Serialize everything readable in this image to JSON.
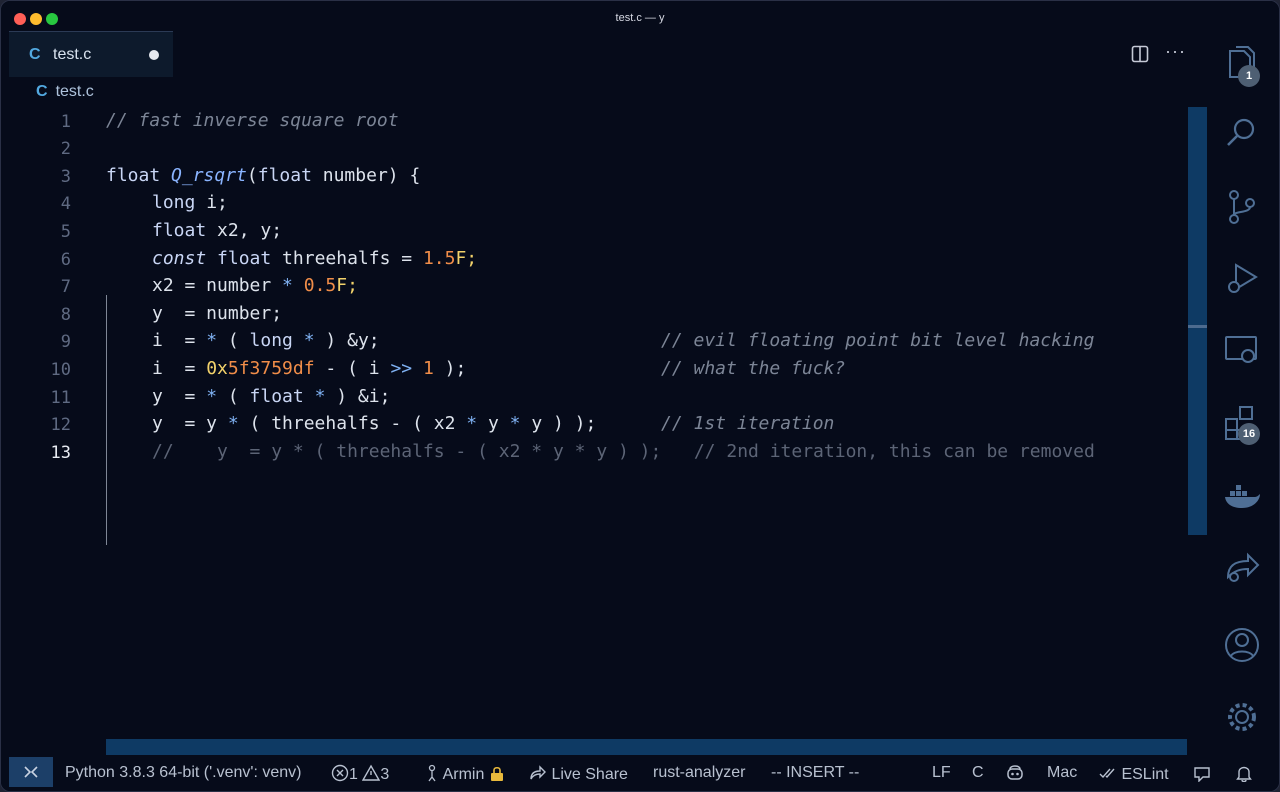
{
  "window": {
    "title": "test.c — y"
  },
  "tab": {
    "icon_letter": "C",
    "name": "test.c"
  },
  "breadcrumb": {
    "icon_letter": "C",
    "file": "test.c"
  },
  "editor": {
    "active_line": 13,
    "lines": [
      {
        "n": "1",
        "comment": "// fast inverse square root"
      },
      {
        "n": "2"
      },
      {
        "n": "3",
        "kw1": "float ",
        "fn": "Q_rsqrt",
        "p1": "(",
        "kw2": "float",
        "rest": " number) {"
      },
      {
        "n": "4",
        "kw": "long",
        "rest": " i;"
      },
      {
        "n": "5",
        "kw": "float",
        "rest": " x2, y;"
      },
      {
        "n": "6",
        "kw_it": "const",
        "kw": " float",
        "rest": " threehalfs = ",
        "num": "1.5",
        "suffix": "F;"
      },
      {
        "n": "7",
        "a": "x2 = number ",
        "op": "*",
        "b": " ",
        "num": "0.5",
        "suffix": "F;"
      },
      {
        "n": "8",
        "a": "y  = number;"
      },
      {
        "n": "9",
        "a": "i  = ",
        "op1": "*",
        "b": " ( ",
        "kw": "long",
        "c": " ",
        "op2": "*",
        "d": " ) &y;",
        "comment": "// evil floating point bit level hacking"
      },
      {
        "n": "10",
        "a": "i  = ",
        "hex_prefix": "0x",
        "hex": "5f3759df",
        "b": " - ( i ",
        "op": ">>",
        "c": " ",
        "num": "1",
        "d": " );",
        "comment": "// what the fuck?"
      },
      {
        "n": "11",
        "a": "y  = ",
        "op1": "*",
        "b": " ( ",
        "kw": "float",
        "c": " ",
        "op2": "*",
        "d": " ) &i;"
      },
      {
        "n": "12",
        "a": "y  = y ",
        "op1": "*",
        "b": " ( threehalfs - ( x2 ",
        "op2": "*",
        "c": " y ",
        "op3": "*",
        "d": " y ) );",
        "comment": "// 1st iteration"
      },
      {
        "n": "13",
        "ghost": "//    y  = y * ( threehalfs - ( x2 * y * y ) );   // 2nd iteration, this can be removed"
      }
    ]
  },
  "activity_bar": {
    "explorer_badge": "1",
    "extensions_badge": "16",
    "icons": [
      "files-icon",
      "search-icon",
      "source-control-icon",
      "run-debug-icon",
      "remote-explorer-icon",
      "extensions-icon",
      "docker-icon",
      "live-share-icon",
      "account-icon",
      "settings-gear-icon"
    ]
  },
  "status_bar": {
    "python": "Python 3.8.3 64-bit ('.venv': venv)",
    "errors": "1",
    "warnings": "3",
    "user": "Armin",
    "live_share": "Live Share",
    "rust": "rust-analyzer",
    "mode": "-- INSERT --",
    "eol": "LF",
    "language": "C",
    "platform": "Mac",
    "eslint": "ESLint"
  },
  "colors": {
    "background": "#060b1a",
    "accent": "#52a9e0",
    "scrollbar": "#0e3a64",
    "number": "#f08d49",
    "comment": "#7c8596"
  }
}
